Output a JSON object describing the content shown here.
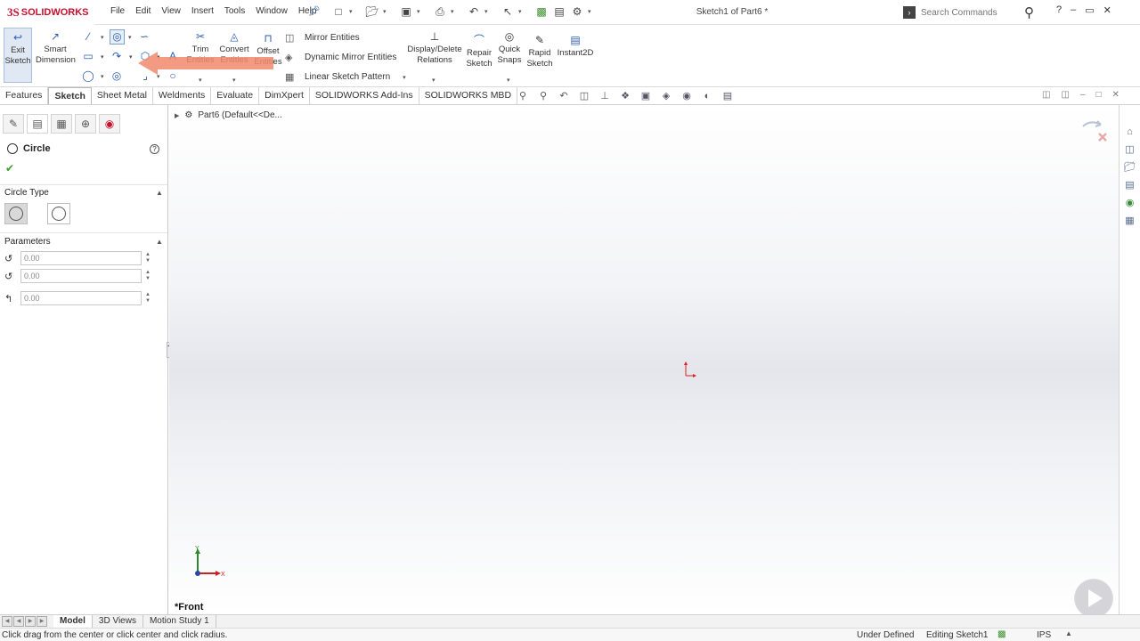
{
  "app": {
    "brand": "SOLIDWORKS",
    "brand_prefix": "3S",
    "doc_title": "Sketch1 of Part6 *"
  },
  "menu": [
    "File",
    "Edit",
    "View",
    "Insert",
    "Tools",
    "Window",
    "Help"
  ],
  "search": {
    "placeholder": "Search Commands"
  },
  "window_controls": [
    "?",
    "–",
    "▭",
    "✕"
  ],
  "ribbon": {
    "exit_sketch": "Exit Sketch",
    "smart_dimension": "Smart Dimension",
    "trim_entities": "Trim Entities",
    "convert_entities": "Convert Entities",
    "offset_entities": "Offset Entities",
    "mirror_entities": "Mirror Entities",
    "dynamic_mirror": "Dynamic Mirror Entities",
    "linear_pattern": "Linear Sketch Pattern",
    "display_delete_relations": "Display/Delete Relations",
    "repair_sketch": "Repair Sketch",
    "quick_snaps": "Quick Snaps",
    "rapid_sketch": "Rapid Sketch",
    "instant2d": "Instant2D"
  },
  "tabs": [
    "Features",
    "Sketch",
    "Sheet Metal",
    "Weldments",
    "Evaluate",
    "DimXpert",
    "SOLIDWORKS Add-Ins",
    "SOLIDWORKS MBD"
  ],
  "active_tab": "Sketch",
  "property_manager": {
    "title": "Circle",
    "circle_type_label": "Circle Type",
    "parameters_label": "Parameters",
    "params": [
      {
        "value": "0.00"
      },
      {
        "value": "0.00"
      },
      {
        "value": "0.00"
      }
    ]
  },
  "graphics": {
    "tree_item": "Part6  (Default<<De...",
    "view_name": "*Front",
    "triad_y": "Y",
    "triad_x": "X"
  },
  "bottom_tabs": [
    "Model",
    "3D Views",
    "Motion Study 1"
  ],
  "status": {
    "message": "Click drag from the center or click center and click radius.",
    "definition": "Under Defined",
    "editing": "Editing Sketch1",
    "units": "IPS"
  },
  "colors": {
    "brand_red": "#c8102e",
    "accent_blue": "#2a5db0",
    "arrow_overlay": "#f08a6c"
  }
}
